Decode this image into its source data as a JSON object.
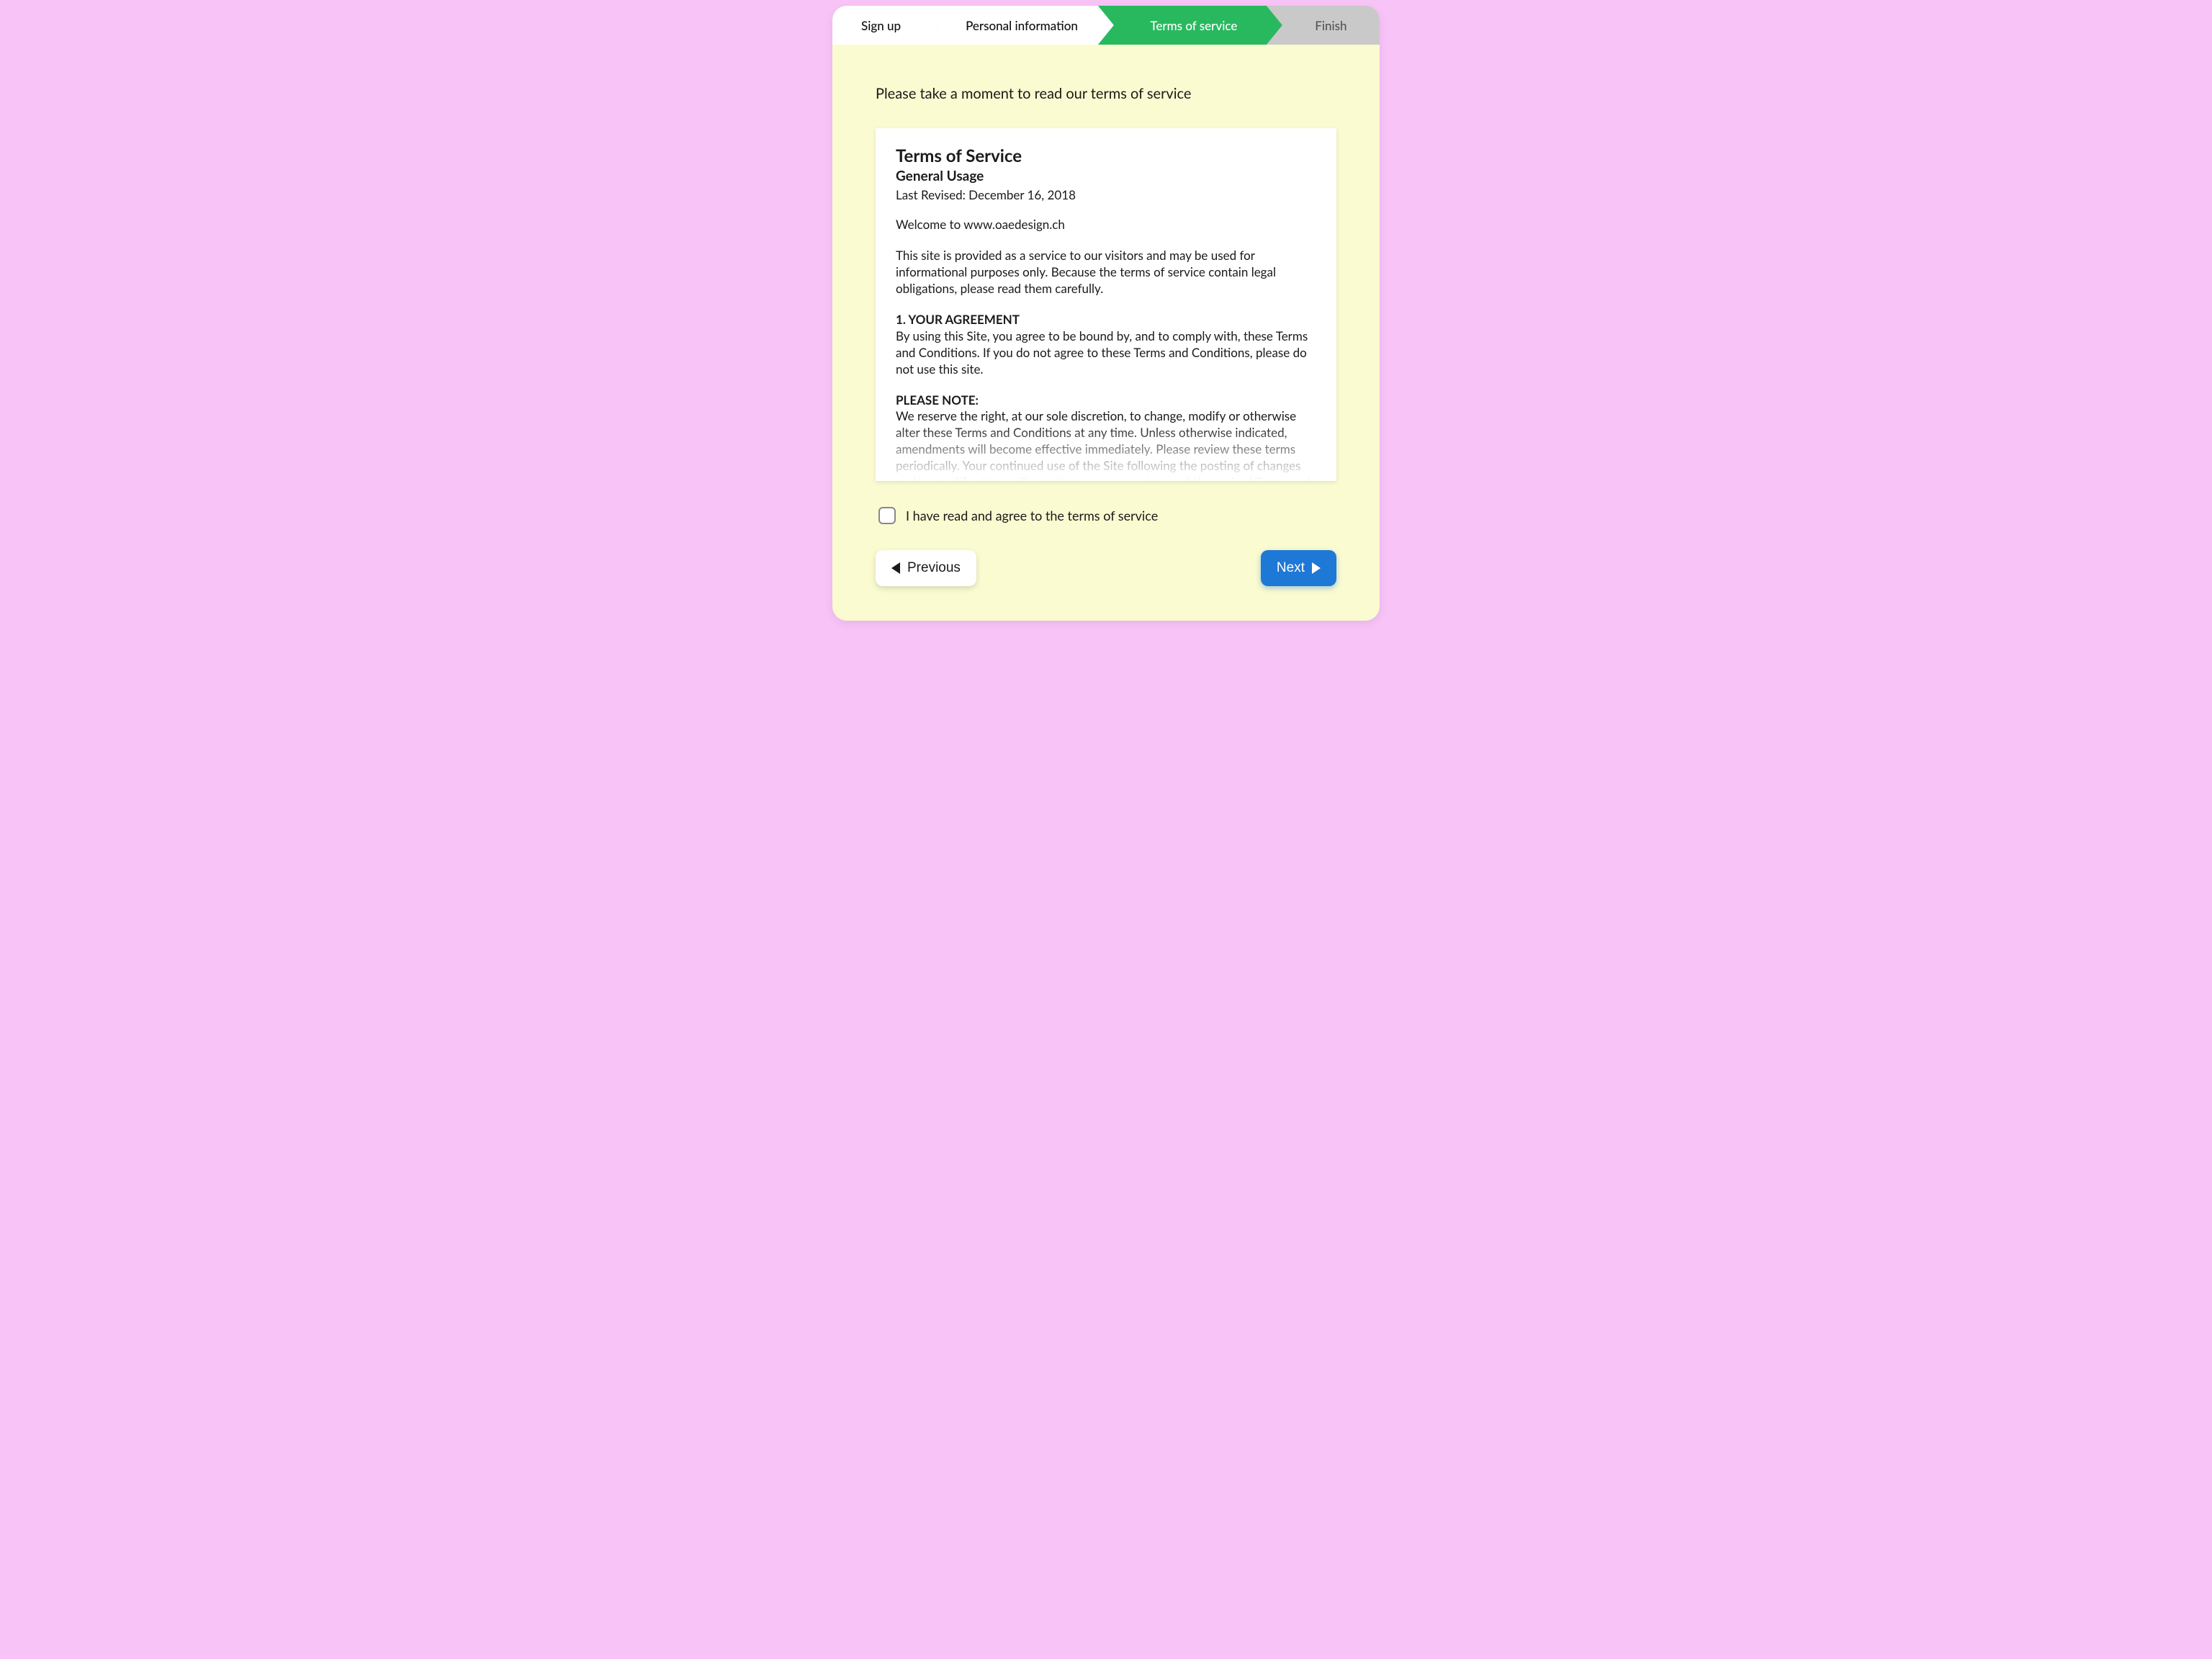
{
  "stepper": {
    "step1": "Sign up",
    "step2": "Personal information",
    "step3": "Terms of service",
    "step4": "Finish"
  },
  "instruction": "Please take a moment to read our terms of service",
  "terms": {
    "title": "Terms of Service",
    "subtitle": "General Usage",
    "revised": "Last Revised: December 16, 2018",
    "welcome": "Welcome to www.oaedesign.ch",
    "intro": "This site is provided as a service to our visitors and may be used for informational purposes only. Because the terms of service contain legal obligations, please read them carefully.",
    "section1_heading": "1. YOUR AGREEMENT",
    "section1_body": "By using this Site, you agree to be bound by, and to comply with, these Terms and Conditions. If you do not agree to these Terms and Conditions, please do not use this site.",
    "note_heading": "PLEASE NOTE:",
    "note_body": "We reserve the right, at our sole discretion, to change, modify or otherwise alter these Terms and Conditions at any time. Unless otherwise indicated, amendments will become effective immediately. Please review these terms periodically. Your continued use of the Site following the posting of changes and/or modifications will constitute your acceptance of the revised Terms and Conditions."
  },
  "agree_label": "I have read and agree to the terms of service",
  "buttons": {
    "previous": "Previous",
    "next": "Next"
  }
}
